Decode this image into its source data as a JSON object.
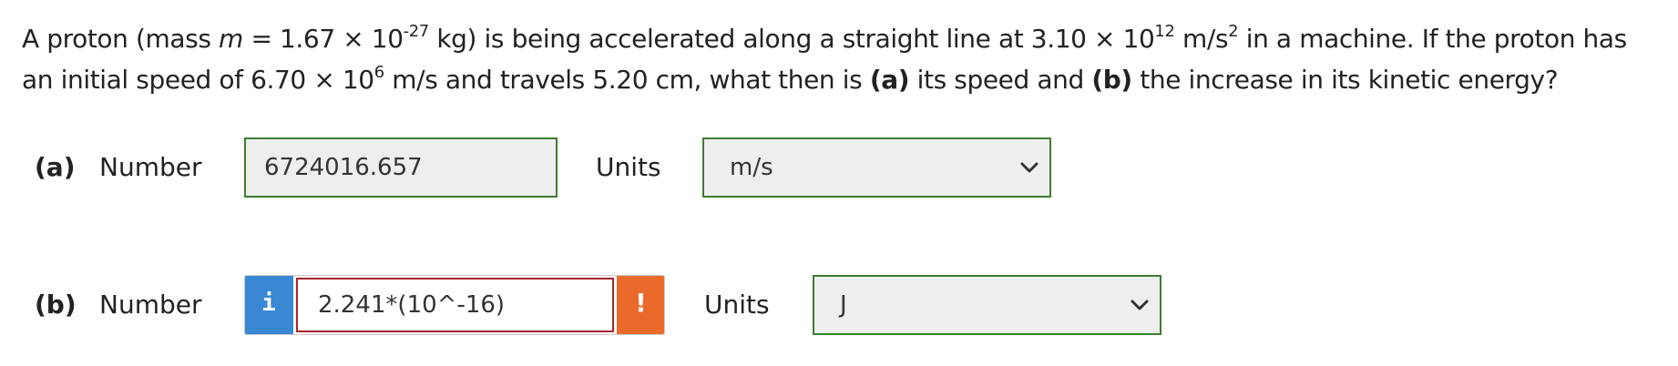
{
  "question": {
    "t1": "A proton (mass ",
    "mass_var": "m",
    "t2": " = 1.67 × 10",
    "exp1": "-27",
    "t3": " kg) is being accelerated along a straight line at 3.10 × 10",
    "exp2": "12",
    "t4": " m/s",
    "exp3": "2",
    "t5": " in a machine. If the proton has an initial speed of 6.70 × 10",
    "exp4": "6",
    "t6": " m/s and travels 5.20 cm, what then is ",
    "part_a": "(a)",
    "t7": " its speed and ",
    "part_b": "(b)",
    "t8": " the increase in its kinetic energy?"
  },
  "part_a": {
    "label": "(a)",
    "number_label": "Number",
    "value": "6724016.657",
    "units_label": "Units",
    "units_value": "m/s"
  },
  "part_b": {
    "label": "(b)",
    "number_label": "Number",
    "info_glyph": "i",
    "value": "2.241*(10^-16)",
    "warn_glyph": "!",
    "units_label": "Units",
    "units_value": "J"
  },
  "icons": {
    "info": "info-icon",
    "warning": "warning-icon",
    "chevron": "chevron-down-icon"
  },
  "colors": {
    "valid_border": "#3e7d31",
    "error_border": "#a3262b",
    "info_blue": "#3a87d4",
    "warning_orange": "#ea6a2c",
    "field_background": "#eeeeee"
  }
}
